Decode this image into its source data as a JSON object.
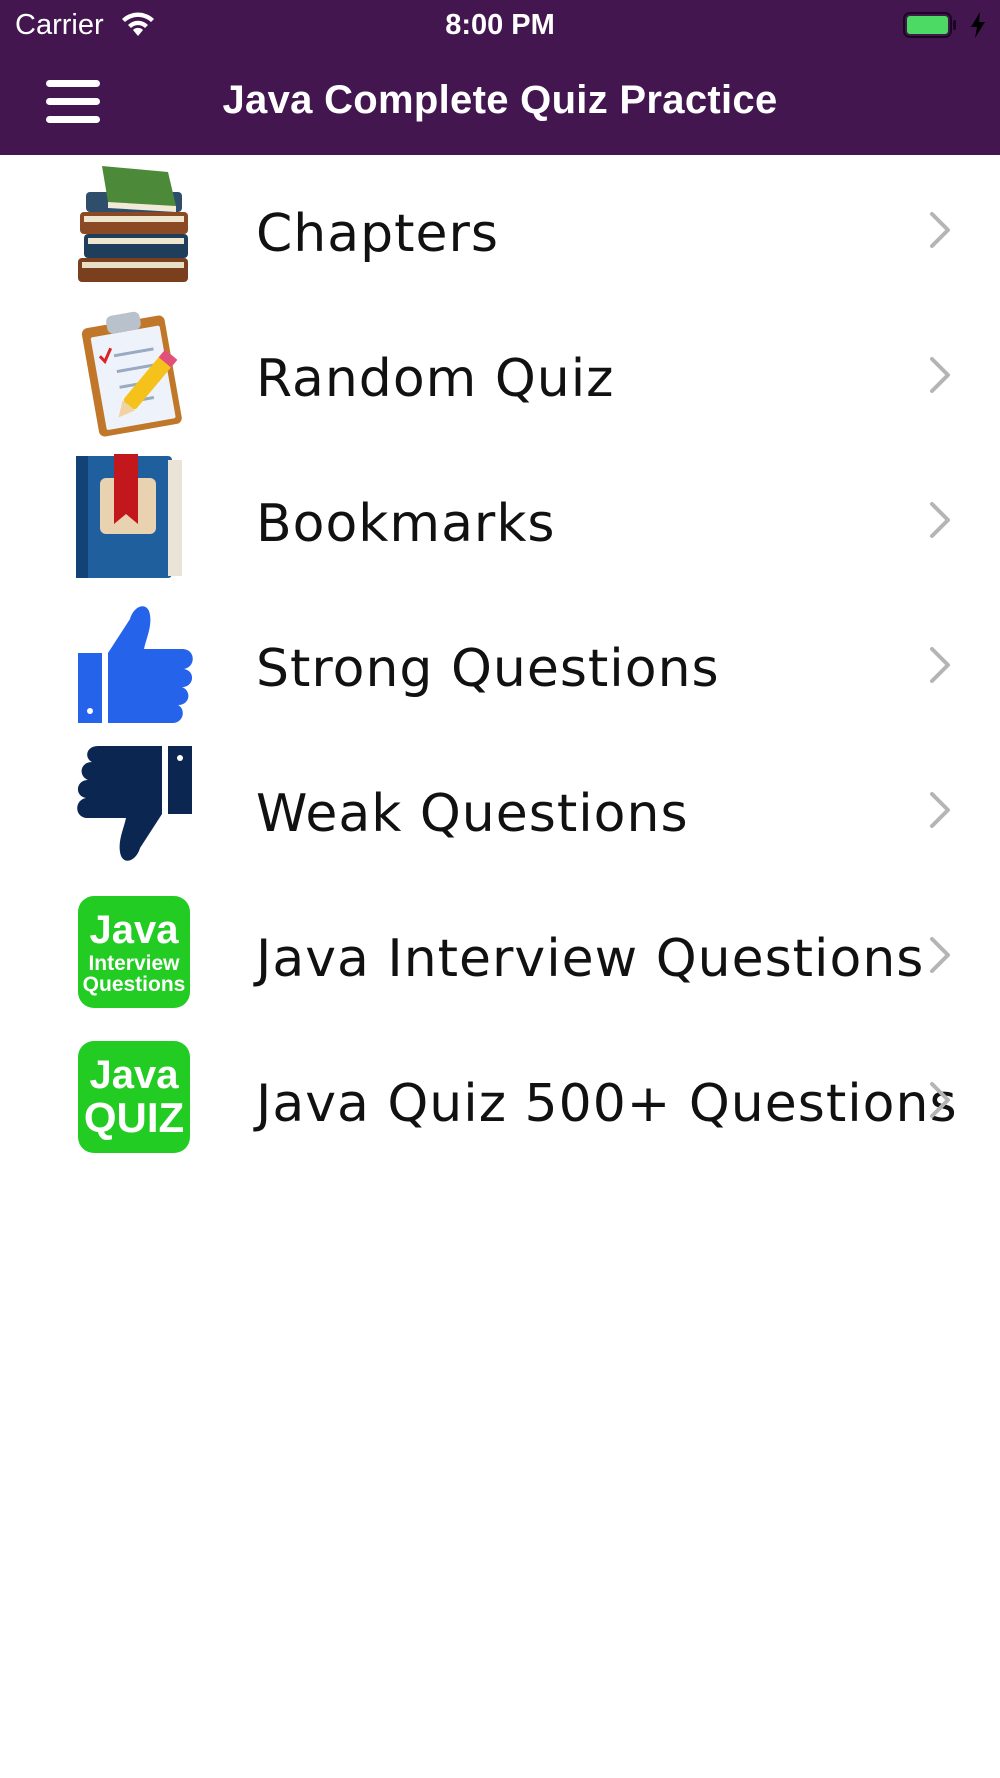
{
  "status_bar": {
    "carrier": "Carrier",
    "time": "8:00 PM"
  },
  "nav": {
    "title": "Java Complete Quiz Practice",
    "menu_icon": "hamburger-menu-icon"
  },
  "menu_items": [
    {
      "label": "Chapters",
      "icon": "books-icon"
    },
    {
      "label": "Random Quiz",
      "icon": "clipboard-pencil-icon"
    },
    {
      "label": "Bookmarks",
      "icon": "bookmark-book-icon"
    },
    {
      "label": "Strong Questions",
      "icon": "thumbs-up-icon"
    },
    {
      "label": "Weak Questions",
      "icon": "thumbs-down-icon"
    },
    {
      "label": "Java Interview Questions",
      "icon": "java-interview-questions-badge-icon",
      "badge_text": [
        "Java",
        "Interview",
        "Questions"
      ]
    },
    {
      "label": "Java Quiz 500+ Questions",
      "icon": "java-quiz-badge-icon",
      "badge_text": [
        "Java",
        "QUIZ"
      ]
    }
  ],
  "colors": {
    "nav_background": "#431650",
    "badge_green": "#22cc22",
    "thumbs_up": "#2563eb",
    "thumbs_down": "#0b2650",
    "battery": "#4cd964"
  }
}
